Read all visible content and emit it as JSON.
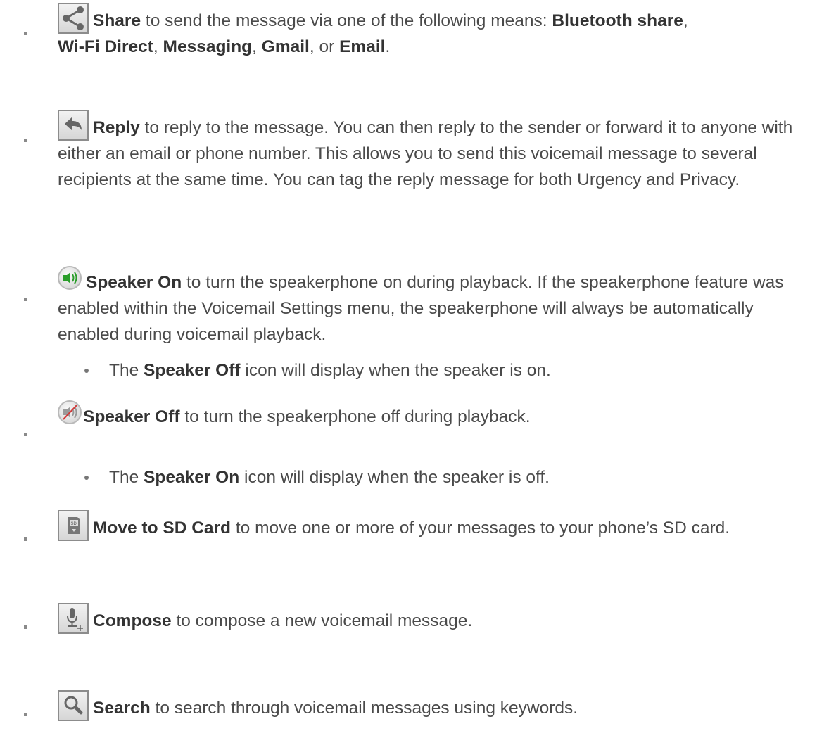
{
  "items": [
    {
      "icon": "share-icon",
      "segments": [
        {
          "t": "Share",
          "b": true
        },
        {
          "t": " to send the message via one of the following means: "
        },
        {
          "t": "Bluetooth share",
          "b": true
        },
        {
          "t": ", "
        },
        {
          "t": "Wi-Fi Direct",
          "b": true
        },
        {
          "t": ", "
        },
        {
          "t": "Messaging",
          "b": true
        },
        {
          "t": ", "
        },
        {
          "t": "Gmail",
          "b": true
        },
        {
          "t": ", or "
        },
        {
          "t": "Email",
          "b": true
        },
        {
          "t": "."
        }
      ]
    },
    {
      "icon": "reply-icon",
      "segments": [
        {
          "t": "Reply",
          "b": true
        },
        {
          "t": " to reply to the message. You can then reply to the sender or forward it to anyone with either an email or phone number. This allows you to send this voicemail message to several recipients at the same time. You can tag the reply message for both Urgency and Privacy."
        }
      ]
    },
    {
      "icon": "speaker-on-icon",
      "segments": [
        {
          "t": "Speaker On",
          "b": true
        },
        {
          "t": " to turn the speakerphone on during playback. If the speakerphone feature was enabled within the Voicemail Settings menu, the speakerphone will always be automatically enabled during voicemail playback."
        }
      ],
      "sub": [
        {
          "t": "The "
        },
        {
          "t": "Speaker Off",
          "b": true
        },
        {
          "t": " icon will display when the speaker is on."
        }
      ]
    },
    {
      "icon": "speaker-off-icon",
      "segments": [
        {
          "t": "Speaker Off",
          "b": true
        },
        {
          "t": " to turn the speakerphone off during playback."
        }
      ],
      "sub": [
        {
          "t": "The "
        },
        {
          "t": "Speaker On",
          "b": true
        },
        {
          "t": " icon will display when the speaker is off."
        }
      ]
    },
    {
      "icon": "sd-card-icon",
      "segments": [
        {
          "t": "Move to SD Card",
          "b": true
        },
        {
          "t": " to move one or more of your messages to your phone’s SD card."
        }
      ]
    },
    {
      "icon": "compose-mic-icon",
      "segments": [
        {
          "t": "Compose",
          "b": true
        },
        {
          "t": " to compose a new voicemail message."
        }
      ]
    },
    {
      "icon": "search-icon",
      "segments": [
        {
          "t": "Search",
          "b": true
        },
        {
          "t": " to search through voicemail messages using keywords."
        }
      ]
    }
  ]
}
